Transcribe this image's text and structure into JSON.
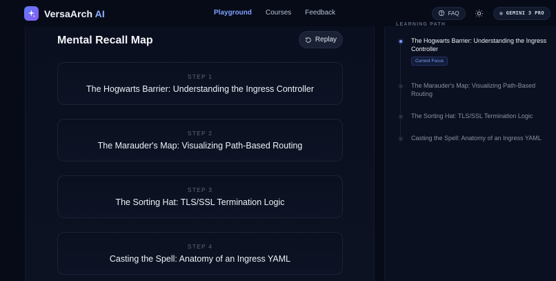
{
  "header": {
    "brand_name": "VersaArch",
    "brand_suffix": "AI",
    "nav": [
      {
        "label": "Playground",
        "active": true
      },
      {
        "label": "Courses",
        "active": false
      },
      {
        "label": "Feedback",
        "active": false
      }
    ],
    "faq_label": "FAQ",
    "model_label": "GEMINI 3 PRO"
  },
  "main": {
    "title": "Mental Recall Map",
    "replay_label": "Replay",
    "steps": [
      {
        "label": "STEP 1",
        "title": "The Hogwarts Barrier: Understanding the Ingress Controller"
      },
      {
        "label": "STEP 2",
        "title": "The Marauder's Map: Visualizing Path-Based Routing"
      },
      {
        "label": "STEP 3",
        "title": "The Sorting Hat: TLS/SSL Termination Logic"
      },
      {
        "label": "STEP 4",
        "title": "Casting the Spell: Anatomy of an Ingress YAML"
      }
    ]
  },
  "sidebar": {
    "heading": "LEARNING PATH",
    "items": [
      {
        "label": "The Hogwarts Barrier: Understanding the Ingress Controller",
        "current": true,
        "badge": "Current Focus"
      },
      {
        "label": "The Marauder's Map: Visualizing Path-Based Routing",
        "current": false
      },
      {
        "label": "The Sorting Hat: TLS/SSL Termination Logic",
        "current": false
      },
      {
        "label": "Casting the Spell: Anatomy of an Ingress YAML",
        "current": false
      }
    ]
  },
  "colors": {
    "accent": "#7ea1ff",
    "background": "#070b18"
  },
  "icons": {
    "logo": "sparkle-icon",
    "faq": "help-circle-icon",
    "theme": "sun-icon",
    "replay": "rewind-icon"
  }
}
